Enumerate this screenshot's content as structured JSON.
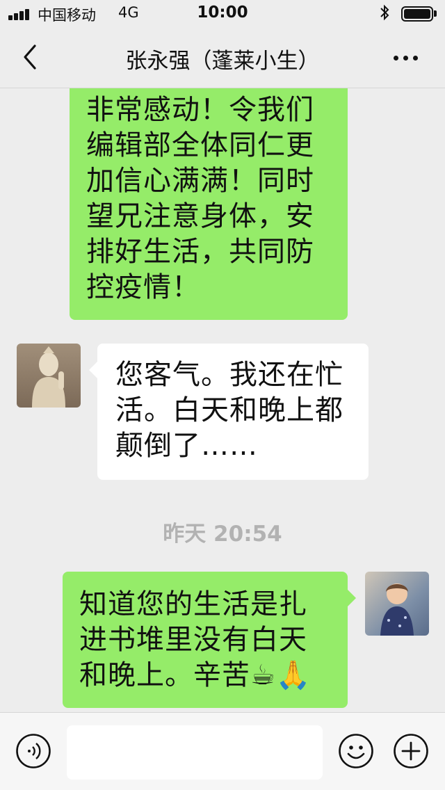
{
  "status_bar": {
    "carrier": "中国移动",
    "network": "4G",
    "time": "10:00",
    "icons": [
      "signal-icon",
      "bluetooth-icon",
      "battery-icon"
    ]
  },
  "nav": {
    "title": "张永强（蓬莱小生）",
    "back_icon": "back-chevron-icon",
    "more_icon": "more-dots-icon"
  },
  "messages": [
    {
      "sender": "self",
      "lines": [
        "非常感动！令我们",
        "编辑部全体同仁更",
        "加信心满满！同时",
        "望兄注意身体，安",
        "排好生活，共同防",
        "控疫情！"
      ]
    },
    {
      "sender": "contact",
      "lines": [
        "您客气。我还在忙",
        "活。白天和晚上都",
        "颠倒了……"
      ]
    },
    {
      "sender": "self",
      "lines": [
        "知道您的生活是扎",
        "进书堆里没有白天",
        "和晚上。辛苦☕🙏"
      ]
    }
  ],
  "timestamp": "昨天 20:54",
  "input_bar": {
    "input_value": "",
    "icons": [
      "voice-icon",
      "emoji-icon",
      "plus-icon"
    ]
  },
  "colors": {
    "self_bubble": "#95ec69",
    "contact_bubble": "#ffffff",
    "background": "#ededed"
  }
}
